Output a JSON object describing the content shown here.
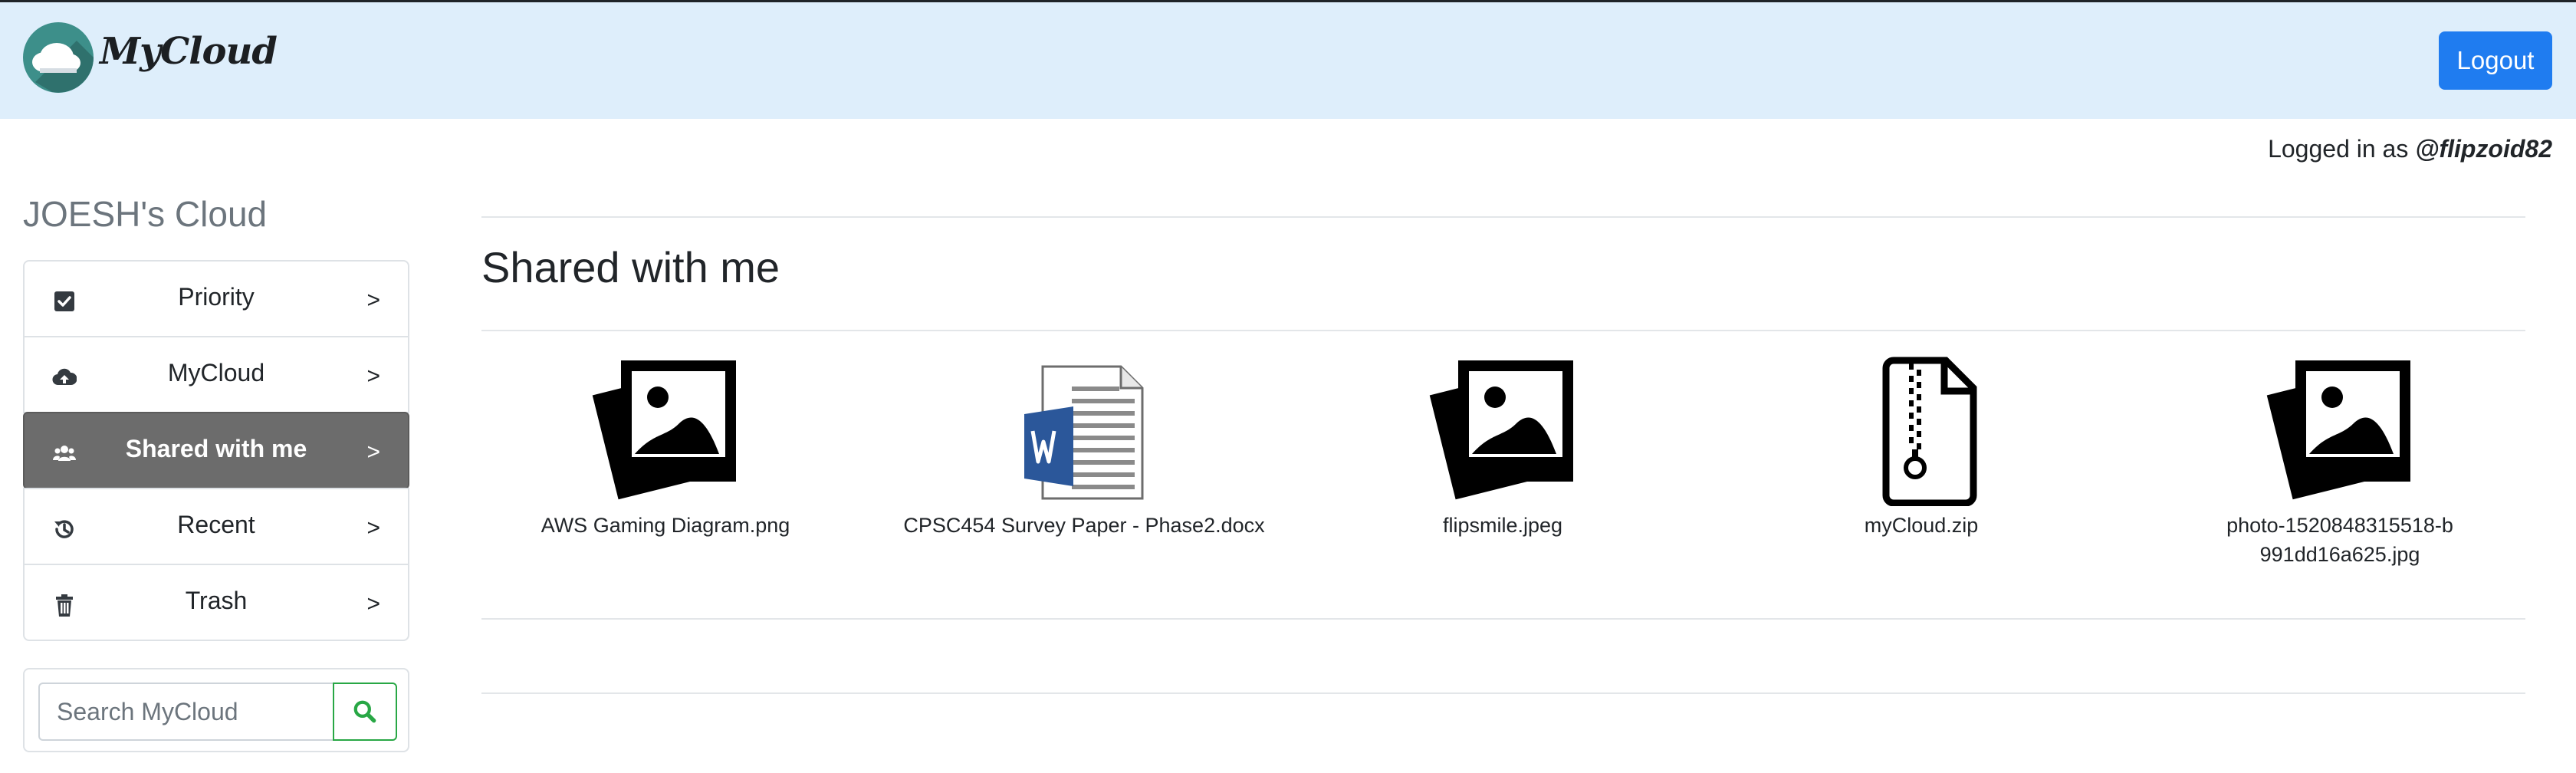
{
  "navbar": {
    "brand": "MyCloud",
    "logout_label": "Logout"
  },
  "user": {
    "logged_in_prefix": "Logged in as ",
    "username": "@flipzoid82"
  },
  "sidebar": {
    "title": "JOESH's Cloud",
    "items": [
      {
        "label": "Priority",
        "icon": "check-square-icon",
        "arrow": ">"
      },
      {
        "label": "MyCloud",
        "icon": "cloud-upload-icon",
        "arrow": ">"
      },
      {
        "label": "Shared with me",
        "icon": "users-icon",
        "arrow": ">",
        "active": true
      },
      {
        "label": "Recent",
        "icon": "history-icon",
        "arrow": ">"
      },
      {
        "label": "Trash",
        "icon": "trash-icon",
        "arrow": ">"
      }
    ],
    "search_placeholder": "Search MyCloud",
    "search_icon": "search-icon"
  },
  "main": {
    "title": "Shared with me",
    "files": [
      {
        "name": "AWS Gaming Diagram.png",
        "icon": "image-file-icon"
      },
      {
        "name": "CPSC454 Survey Paper - Phase2.docx",
        "icon": "word-document-icon"
      },
      {
        "name": "flipsmile.jpeg",
        "icon": "image-file-icon"
      },
      {
        "name": "myCloud.zip",
        "icon": "zip-file-icon"
      },
      {
        "name": "photo-1520848315518-b991dd16a625.jpg",
        "icon": "image-file-icon"
      }
    ]
  },
  "colors": {
    "navbar_bg": "#deeefb",
    "logout_bg": "#1f7cf0",
    "active_item_bg": "#6c6c6c",
    "search_button_border": "#28a745",
    "sidebar_title": "#6c757d"
  }
}
